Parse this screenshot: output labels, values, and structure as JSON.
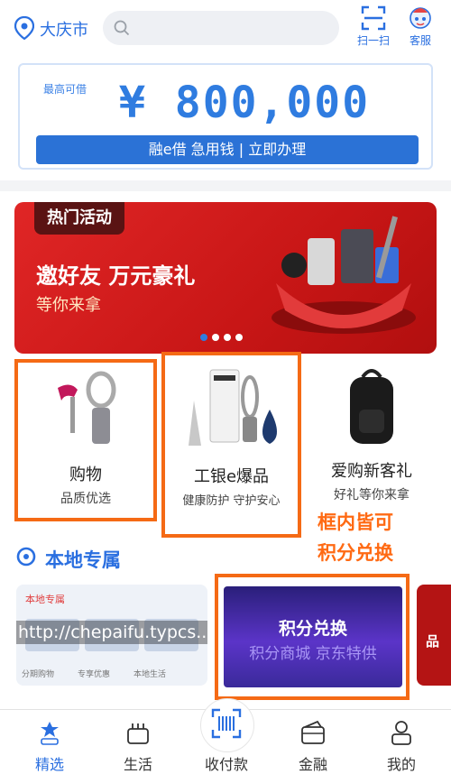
{
  "header": {
    "city": "大庆市",
    "search_placeholder": "",
    "scan_label": "扫一扫",
    "service_label": "客服"
  },
  "loan": {
    "label": "最高可借",
    "amount": "¥ 800,000",
    "button_label": "融e借 急用钱 | 立即办理"
  },
  "banner": {
    "tag": "热门活动",
    "title": "邀好友 万元豪礼",
    "subtitle": "等你来拿",
    "dots_total": 4,
    "dots_active": 1
  },
  "products": [
    {
      "title": "购物",
      "subtitle": "品质优选"
    },
    {
      "title": "工银e爆品",
      "subtitle": "健康防护 守护安心"
    },
    {
      "title": "爱购新客礼",
      "subtitle": "好礼等你来拿"
    }
  ],
  "annotation": {
    "line1": "框内皆可",
    "line2": "积分兑换"
  },
  "local": {
    "title": "本地专属",
    "cards": {
      "left_header": "本地专属",
      "left_url": "http://chepaifu.typcs...",
      "left_tabs": [
        "分期购物",
        "专享优惠",
        "本地生活"
      ],
      "mid_title": "积分兑换",
      "mid_ghost": "积分商城 京东特供",
      "right_label": "品"
    }
  },
  "nav": {
    "items": [
      {
        "label": "精选",
        "icon": "home-icon"
      },
      {
        "label": "生活",
        "icon": "life-icon"
      },
      {
        "label": "收付款",
        "icon": "qr-pay-icon"
      },
      {
        "label": "金融",
        "icon": "wallet-icon"
      },
      {
        "label": "我的",
        "icon": "profile-icon"
      }
    ]
  },
  "colors": {
    "brand_blue": "#2a6fe0",
    "highlight_orange": "#f56a15",
    "banner_red": "#d61f1f"
  }
}
